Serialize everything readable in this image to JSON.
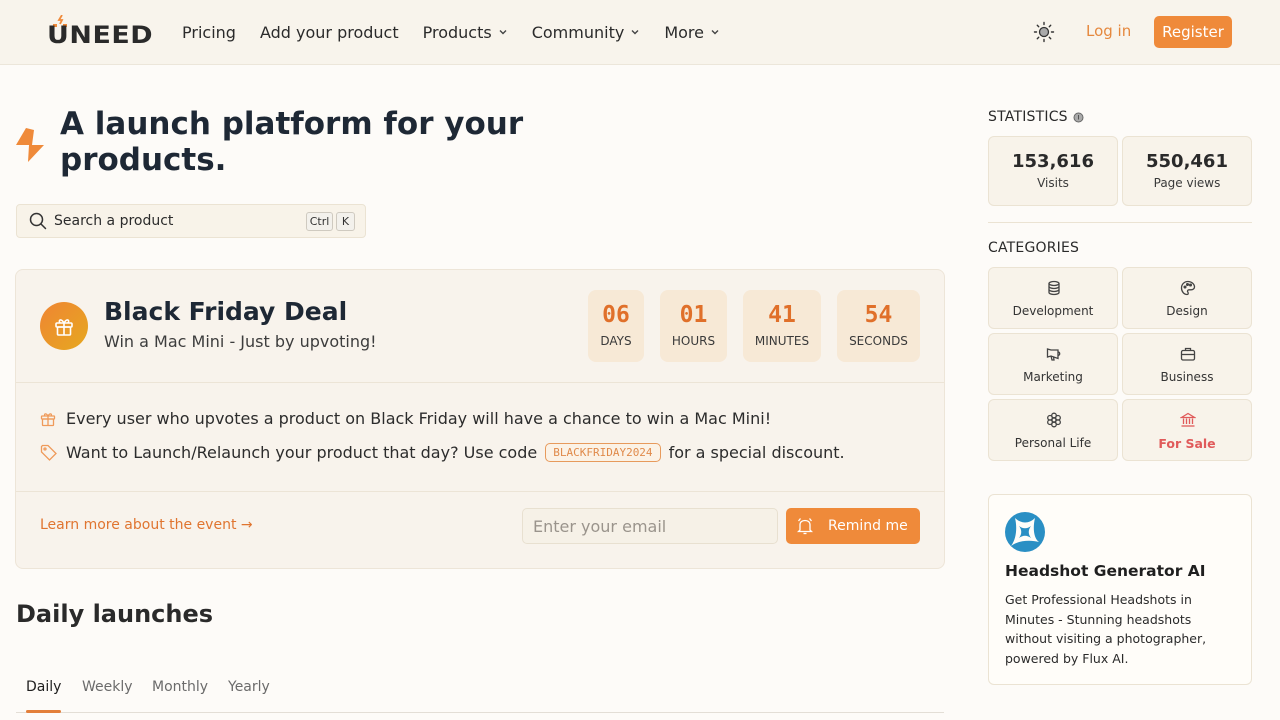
{
  "header": {
    "logo_text": "UNEED",
    "nav": [
      {
        "label": "Pricing",
        "has_dropdown": false
      },
      {
        "label": "Add your product",
        "has_dropdown": false
      },
      {
        "label": "Products",
        "has_dropdown": true
      },
      {
        "label": "Community",
        "has_dropdown": true
      },
      {
        "label": "More",
        "has_dropdown": true
      }
    ],
    "theme_icon": "sun-icon",
    "login_label": "Log in",
    "register_label": "Register"
  },
  "hero": {
    "title": "A launch platform for your products.",
    "search_placeholder": "Search a product",
    "shortcut_keys": [
      "Ctrl",
      "K"
    ]
  },
  "deal": {
    "title": "Black Friday Deal",
    "subtitle": "Win a Mac Mini - Just by upvoting!",
    "countdown": [
      {
        "value": "06",
        "label": "DAYS"
      },
      {
        "value": "01",
        "label": "HOURS"
      },
      {
        "value": "41",
        "label": "MINUTES"
      },
      {
        "value": "54",
        "label": "SECONDS"
      }
    ],
    "line1": "Every user who upvotes a product on Black Friday will have a chance to win a Mac Mini!",
    "line2_before": "Want to Launch/Relaunch your product that day? Use code",
    "promo_code": "BLACKFRIDAY2024",
    "line2_after": "for a special discount.",
    "learn_more": "Learn more about the event →",
    "email_placeholder": "Enter your email",
    "remind_label": "Remind me"
  },
  "launches": {
    "title": "Daily launches",
    "tabs": [
      {
        "label": "Daily",
        "active": true
      },
      {
        "label": "Weekly",
        "active": false
      },
      {
        "label": "Monthly",
        "active": false
      },
      {
        "label": "Yearly",
        "active": false
      }
    ]
  },
  "sidebar": {
    "statistics_heading": "STATISTICS",
    "stats": [
      {
        "value": "153,616",
        "label": "Visits"
      },
      {
        "value": "550,461",
        "label": "Page views"
      }
    ],
    "categories_heading": "CATEGORIES",
    "categories": [
      {
        "label": "Development",
        "icon": "database-icon"
      },
      {
        "label": "Design",
        "icon": "palette-icon"
      },
      {
        "label": "Marketing",
        "icon": "megaphone-icon"
      },
      {
        "label": "Business",
        "icon": "briefcase-icon"
      },
      {
        "label": "Personal Life",
        "icon": "flower-icon"
      },
      {
        "label": "For Sale",
        "icon": "bank-icon",
        "highlight": true
      }
    ],
    "promo": {
      "title": "Headshot Generator AI",
      "description": "Get Professional Headshots in Minutes - Stunning headshots without visiting a photographer, powered by Flux AI."
    }
  },
  "colors": {
    "accent": "#ef8a3a",
    "header_bg": "#f8f4ec",
    "page_bg": "#fdfbf8",
    "countdown_text": "#e0702a",
    "for_sale": "#e05a5a",
    "promo_logo": "#2a8fc4"
  }
}
